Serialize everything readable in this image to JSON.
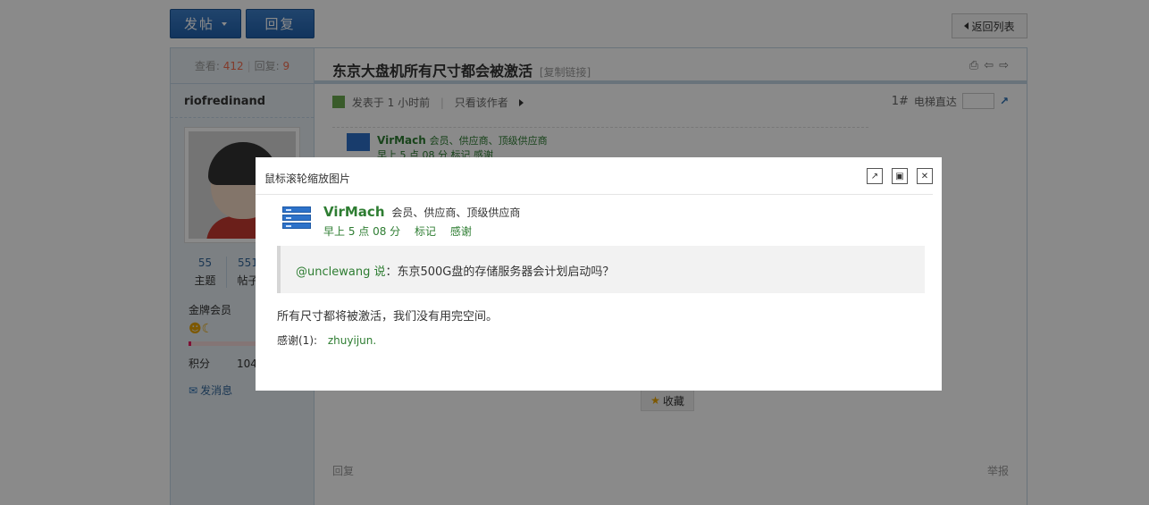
{
  "toolbar": {
    "post_label": "发帖",
    "reply_label": "回复",
    "back_label": "返回列表"
  },
  "sidebar": {
    "views_label": "查看:",
    "views": "412",
    "replies_label": "回复:",
    "replies": "9",
    "author": "riofredinand",
    "topics_value": "55",
    "topics_label": "主题",
    "posts_value": "551",
    "posts_label": "帖子",
    "rank": "金牌会员",
    "score_label": "积分",
    "score_value": "104",
    "send_message": "发消息"
  },
  "thread": {
    "title": "东京大盘机所有尺寸都会被激活",
    "copy_link": "[复制链接]",
    "posted": "发表于 1 小时前",
    "only_author": "只看该作者",
    "floor": "1#",
    "jump_label": "电梯直达",
    "quoted_name": "VirMach",
    "quoted_tags": "会员、供应商、顶级供应商",
    "quoted_meta": "早上 5 点 08 分  标记  感谢",
    "favorite": "收藏",
    "reply_link": "回复",
    "report_link": "举报"
  },
  "modal": {
    "title": "鼠标滚轮缩放图片",
    "post": {
      "author": "VirMach",
      "tags": "会员、供应商、顶级供应商",
      "time": "早上 5 点 08 分",
      "mark": "标记",
      "thank": "感谢",
      "quote_user": "@unclewang 说",
      "quote_text": "：东京500G盘的存储服务器会计划启动吗？",
      "body": "所有尺寸都将被激活，我们没有用完空间。",
      "thanks_label": "感谢(1):",
      "thanks_users": "zhuyijun."
    }
  }
}
